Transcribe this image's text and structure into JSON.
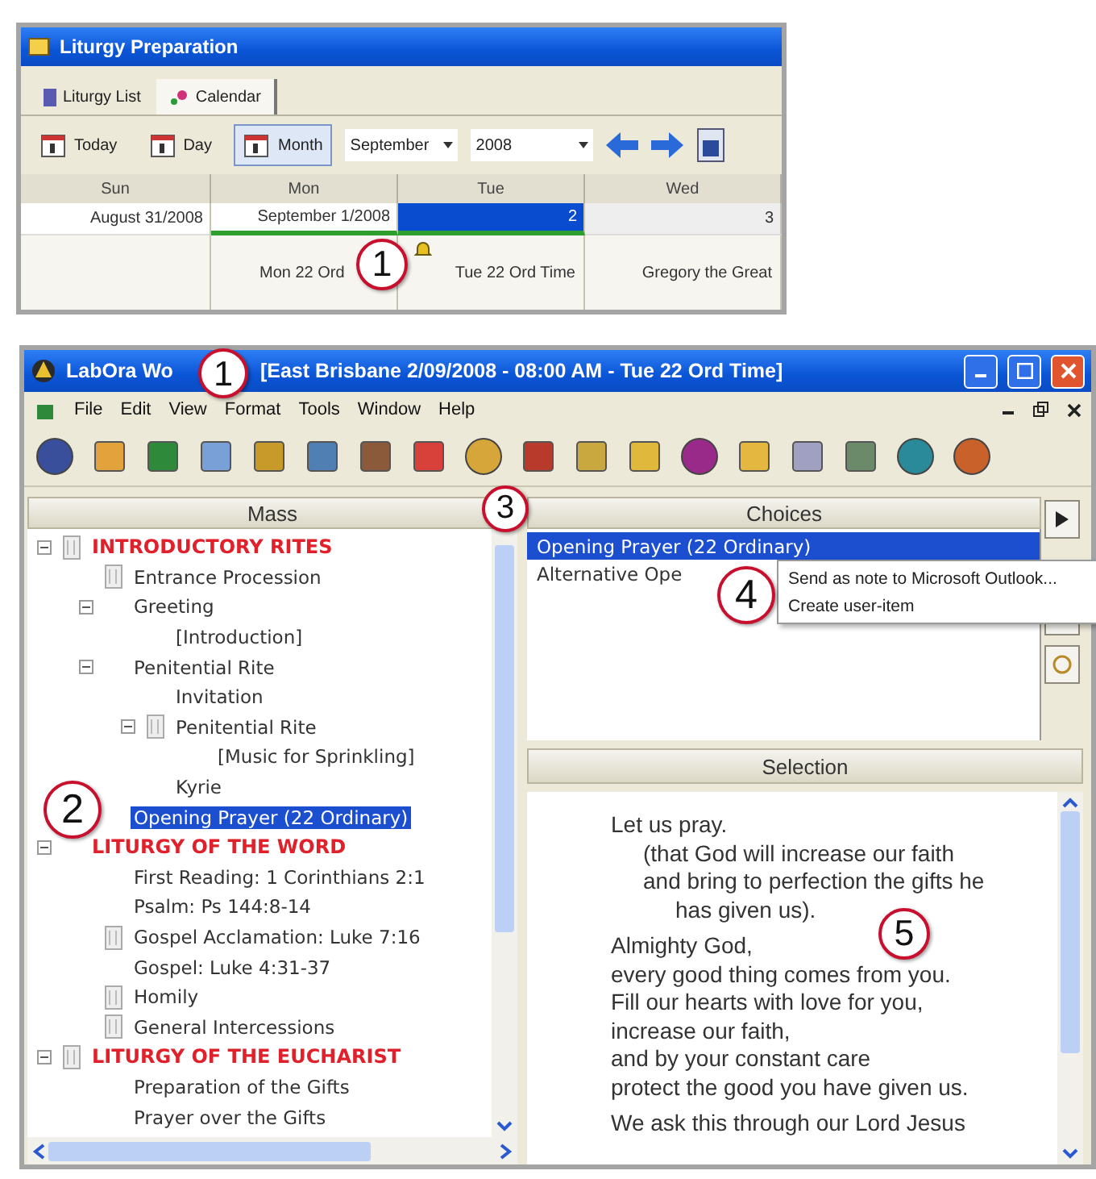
{
  "calendar_window": {
    "title": "Liturgy Preparation",
    "tabs": [
      {
        "label": "Liturgy List",
        "selected": false
      },
      {
        "label": "Calendar",
        "selected": true
      }
    ],
    "view_buttons": [
      {
        "label": "Today",
        "selected": false
      },
      {
        "label": "Day",
        "selected": false
      },
      {
        "label": "Month",
        "selected": true
      }
    ],
    "month": "September",
    "year": "2008",
    "days": [
      "Sun",
      "Mon",
      "Tue",
      "Wed"
    ],
    "dates": [
      {
        "label": "August 31/2008",
        "selected": false,
        "highlighted": false
      },
      {
        "label": "September 1/2008",
        "selected": false,
        "highlighted": true
      },
      {
        "label": "2",
        "selected": true,
        "highlighted": true
      },
      {
        "label": "3",
        "selected": false,
        "highlighted": false
      }
    ],
    "entries": [
      {
        "text": "Mon 22 Ord",
        "bell": false
      },
      {
        "text": "Tue 22 Ord Time",
        "bell": true
      },
      {
        "text": "Gregory the Great",
        "bell": false
      }
    ]
  },
  "main_window": {
    "title": "LabOra Wo",
    "title_detail": "[East Brisbane 2/09/2008 - 08:00 AM - Tue 22 Ord Time]",
    "menu": [
      "File",
      "Edit",
      "View",
      "Format",
      "Tools",
      "Window",
      "Help"
    ],
    "mass": {
      "header": "Mass",
      "tree": [
        {
          "label": "INTRODUCTORY RITES",
          "kind": "section",
          "icon": true,
          "expanded": true,
          "selected": false,
          "children": [
            {
              "label": "Entrance Procession",
              "kind": "item",
              "icon": true,
              "selected": false
            },
            {
              "label": "Greeting",
              "kind": "item",
              "icon": false,
              "expanded": true,
              "selected": false,
              "children": [
                {
                  "label": "[Introduction]",
                  "kind": "item",
                  "icon": false,
                  "selected": false
                }
              ]
            },
            {
              "label": "Penitential Rite",
              "kind": "item",
              "icon": false,
              "expanded": true,
              "selected": false,
              "children": [
                {
                  "label": "Invitation",
                  "kind": "item",
                  "icon": false,
                  "selected": false
                },
                {
                  "label": "Penitential Rite",
                  "kind": "item",
                  "icon": true,
                  "expanded": true,
                  "selected": false,
                  "children": [
                    {
                      "label": "[Music for Sprinkling]",
                      "kind": "item",
                      "icon": false,
                      "selected": false
                    }
                  ]
                },
                {
                  "label": "Kyrie",
                  "kind": "item",
                  "icon": false,
                  "selected": false
                }
              ]
            },
            {
              "label": "Opening Prayer (22 Ordinary)",
              "kind": "item",
              "icon": false,
              "selected": true
            }
          ]
        },
        {
          "label": "LITURGY OF THE WORD",
          "kind": "section",
          "icon": false,
          "expanded": true,
          "selected": false,
          "children": [
            {
              "label": "First Reading: 1 Corinthians 2:1",
              "kind": "item",
              "icon": false,
              "selected": false
            },
            {
              "label": "Psalm: Ps 144:8-14",
              "kind": "item",
              "icon": false,
              "selected": false
            },
            {
              "label": "Gospel Acclamation: Luke 7:16",
              "kind": "item",
              "icon": true,
              "selected": false
            },
            {
              "label": "Gospel: Luke 4:31-37",
              "kind": "item",
              "icon": false,
              "selected": false
            },
            {
              "label": "Homily",
              "kind": "item",
              "icon": true,
              "selected": false
            },
            {
              "label": "General Intercessions",
              "kind": "item",
              "icon": true,
              "selected": false
            }
          ]
        },
        {
          "label": "LITURGY OF THE EUCHARIST",
          "kind": "section",
          "icon": true,
          "expanded": true,
          "selected": false,
          "children": [
            {
              "label": "Preparation of the Gifts",
              "kind": "item",
              "icon": false,
              "selected": false
            },
            {
              "label": "Prayer over the Gifts",
              "kind": "item",
              "icon": false,
              "selected": false
            }
          ]
        }
      ]
    },
    "choices": {
      "header": "Choices",
      "items": [
        {
          "label": "Opening Prayer (22 Ordinary)",
          "selected": true
        },
        {
          "label": "Alternative Ope",
          "selected": false
        }
      ]
    },
    "context_menu": [
      "Send as note to Microsoft Outlook...",
      "Create user-item"
    ],
    "selection": {
      "header": "Selection",
      "paragraphs": [
        [
          {
            "text": "Let us pray.",
            "kind": "line"
          },
          {
            "text": "(that God will increase our faith",
            "kind": "indent"
          },
          {
            "text": "and bring to perfection the gifts he",
            "kind": "indent"
          },
          {
            "text": "has given us).",
            "kind": "indent2"
          }
        ],
        [
          {
            "text": "Almighty God,",
            "kind": "line"
          },
          {
            "text": "every good thing comes from you.",
            "kind": "line"
          },
          {
            "text": "Fill our hearts with love for you,",
            "kind": "line"
          },
          {
            "text": "increase our faith,",
            "kind": "line"
          },
          {
            "text": "and by your constant care",
            "kind": "line"
          },
          {
            "text": "protect the good you have given us.",
            "kind": "line"
          }
        ],
        [
          {
            "text": "We ask this through our Lord Jesus",
            "kind": "line"
          }
        ]
      ]
    }
  },
  "callouts": [
    "1",
    "1",
    "2",
    "3",
    "4",
    "5"
  ]
}
